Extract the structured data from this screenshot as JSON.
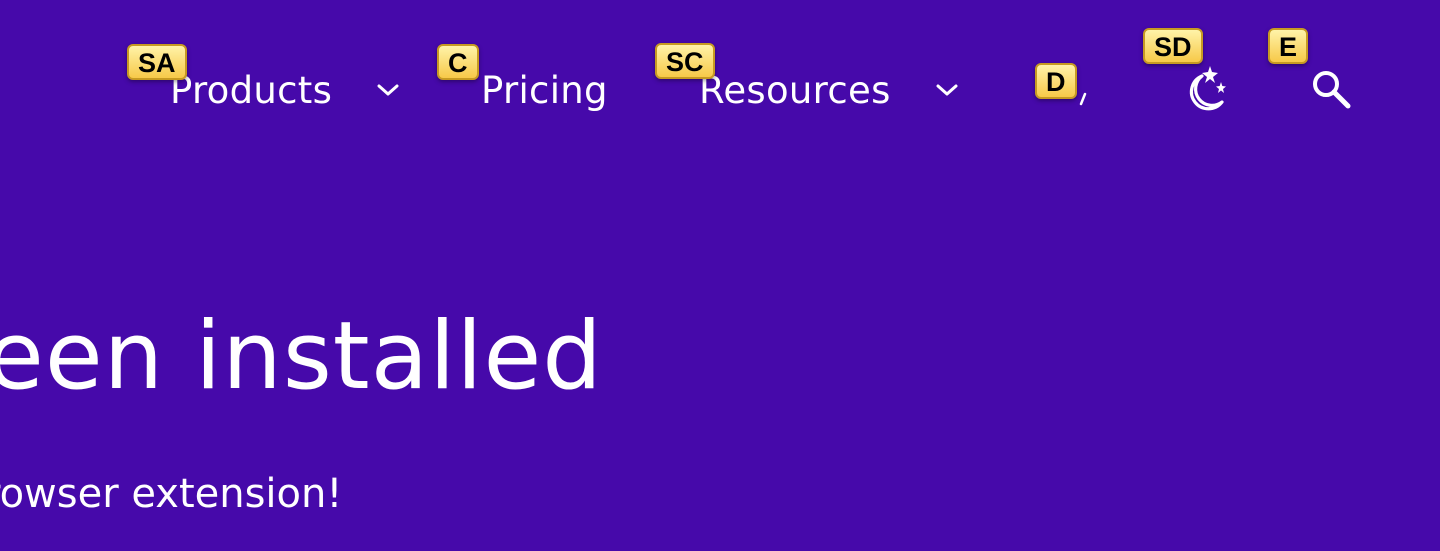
{
  "nav": {
    "products": {
      "label": "Products",
      "hint": "SA"
    },
    "pricing": {
      "label": "Pricing",
      "hint": "C"
    },
    "resources": {
      "label": "Resources",
      "hint": "SC"
    },
    "account": {
      "hint": "D"
    },
    "theme_toggle": {
      "hint": "SD",
      "icon": "moon-stars-icon"
    },
    "search": {
      "hint": "E",
      "icon": "search-icon"
    }
  },
  "hero": {
    "headline": "een installed",
    "subline": "rowser extension!"
  },
  "colors": {
    "background": "#4609aa",
    "text": "#ffffff",
    "hint_background": "#f7c948"
  }
}
